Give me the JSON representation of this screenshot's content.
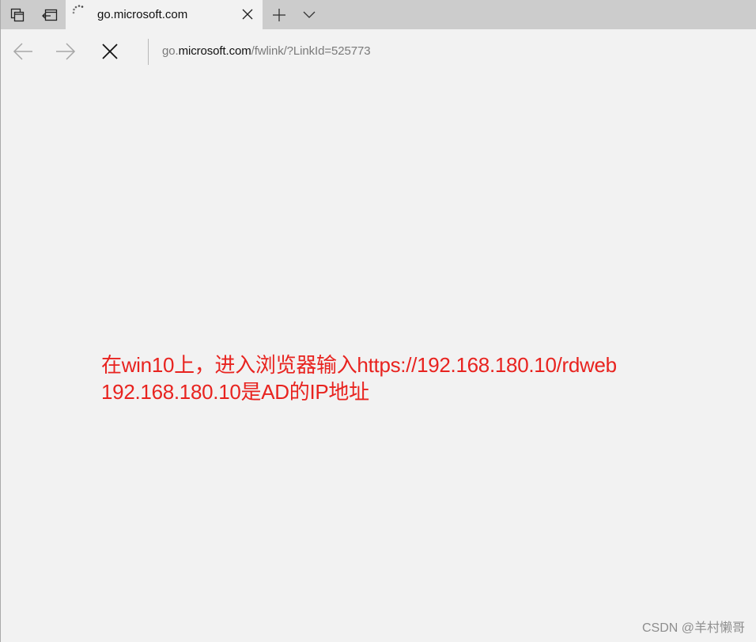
{
  "tab": {
    "title": "go.microsoft.com",
    "loading": true
  },
  "address": {
    "prefix": "go.",
    "domain": "microsoft.com",
    "path": "/fwlink/?LinkId=525773"
  },
  "icons": {
    "tab_manager": "tab-manager-icon",
    "set_aside": "set-aside-tabs-icon",
    "close_tab": "close-icon",
    "new_tab": "plus-icon",
    "tab_preview": "chevron-down-icon",
    "back": "back-arrow-icon",
    "forward": "forward-arrow-icon",
    "stop": "stop-icon"
  },
  "annotation": {
    "line1": "在win10上，进入浏览器输入https://192.168.180.10/rdweb",
    "line2": "192.168.180.10是AD的IP地址"
  },
  "watermark": "CSDN @羊村懒哥",
  "colors": {
    "tabstrip": "#cccccc",
    "page_bg": "#f2f2f2",
    "annotation": "#e8231f"
  }
}
